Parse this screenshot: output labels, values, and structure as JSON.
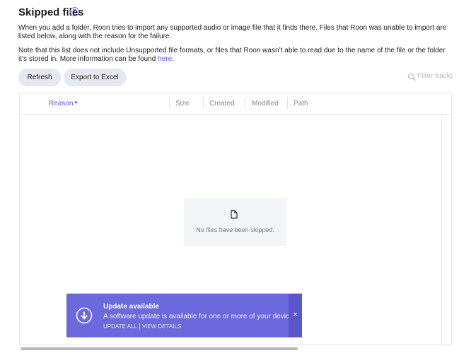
{
  "page": {
    "title": "Skipped files",
    "help_icon": "?",
    "description_1": "When you add a folder, Roon tries to import any supported audio or image file that it finds there. Files that Roon was unable to import are listed below, along with the reason for the failure.",
    "description_2_prefix": "Note that this list does not include Unsupported file formats, or files that Roon wasn’t able to read due to the name of the file or the folder it’s stored in. More information can be found ",
    "description_2_link": "here",
    "description_2_suffix": "."
  },
  "toolbar": {
    "refresh_label": "Refresh",
    "export_label": "Export to Excel",
    "filter_placeholder": "Filter tracks"
  },
  "table": {
    "columns": [
      "Reason",
      "Size",
      "Created",
      "Modified",
      "Path"
    ],
    "sort_indicator": "▲",
    "empty_message": "No files have been skipped."
  },
  "toast": {
    "title": "Update available",
    "message": "A software update is available for one or more of your devices.",
    "action_update_all": "UPDATE ALL",
    "action_view_details": "VIEW DETAILS",
    "close": "×"
  },
  "colors": {
    "accent": "#5c5ad8",
    "toast_bg": "#6c68de",
    "button_bg": "#e6e8f0"
  },
  "icons": {
    "help": "help-icon",
    "search": "search-icon",
    "file": "file-icon",
    "download": "download-icon",
    "close": "close-icon"
  }
}
